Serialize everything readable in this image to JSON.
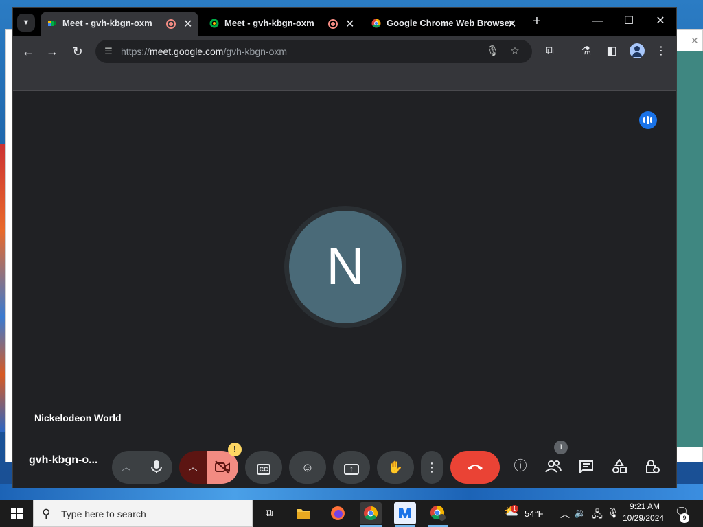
{
  "browser": {
    "tabs": [
      {
        "title": "Meet - gvh-kbgn-oxm",
        "active": true,
        "recording": true
      },
      {
        "title": "Meet - gvh-kbgn-oxm",
        "active": false,
        "recording": true
      },
      {
        "title": "Google Chrome Web Browser",
        "active": false,
        "recording": false
      }
    ],
    "new_tab_label": "+",
    "url_scheme": "https://",
    "url_host": "meet.google.com",
    "url_path": "/gvh-kbgn-oxm"
  },
  "meet": {
    "avatar_letter": "N",
    "participant_name": "Nickelodeon World",
    "meeting_code": "gvh-kbgn-o...",
    "people_count": "1",
    "camera_warning": "!"
  },
  "taskbar": {
    "search_placeholder": "Type here to search",
    "weather_temp": "54°F",
    "weather_alert": "1",
    "time": "9:21 AM",
    "date": "10/29/2024",
    "notification_count": "9"
  },
  "colors": {
    "meet_bg": "#202124",
    "end_call": "#ea4335",
    "camera_off": "#f28b82",
    "avatar": "#4a6a78",
    "speaking_badge": "#1a73e8"
  }
}
